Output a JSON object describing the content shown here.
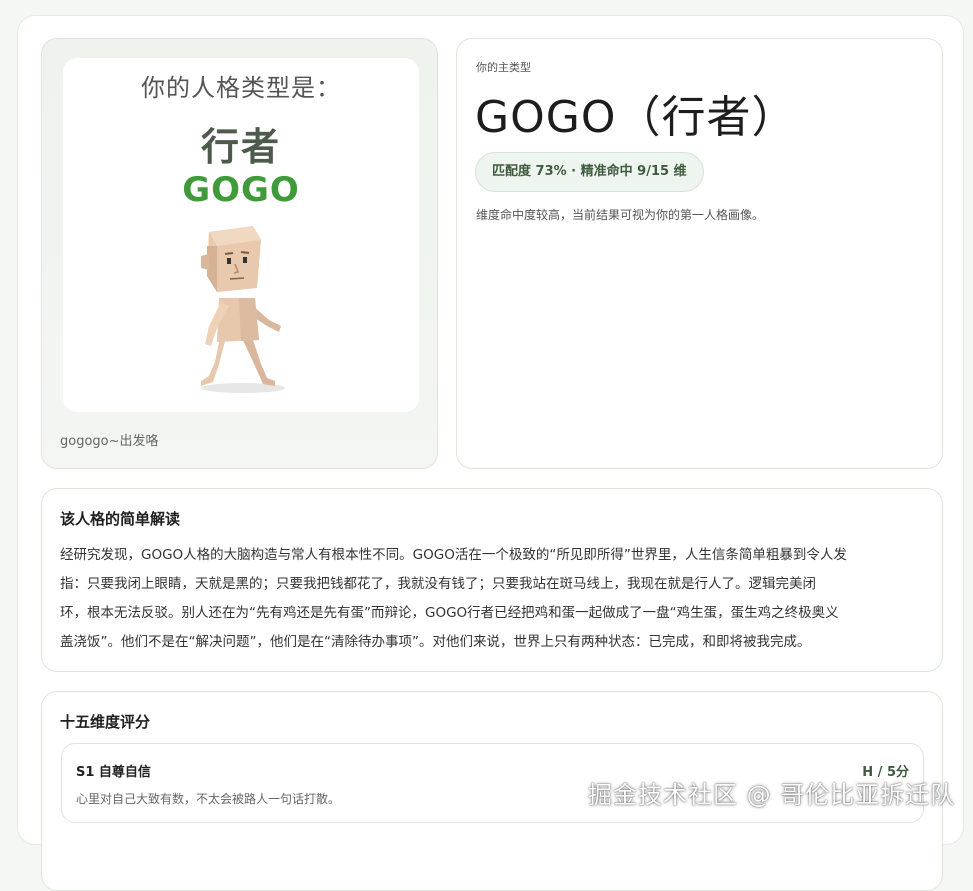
{
  "poster": {
    "heading": "你的人格类型是：",
    "name_cn": "行者",
    "name_en": "GOGO",
    "caption": "gogogo~出发咯"
  },
  "main_type": {
    "eyebrow": "你的主类型",
    "name": "GOGO（行者）",
    "badge": "匹配度 73% · 精准命中 9/15 维",
    "description": "维度命中度较高，当前结果可视为你的第一人格画像。"
  },
  "interpretation": {
    "title": "该人格的简单解读",
    "lines": [
      "经研究发现，GOGO人格的大脑构造与常人有根本性不同。GOGO活在一个极致的“所见即所得”世界里，人生信条简单粗暴到令人发",
      "指：只要我闭上眼睛，天就是黑的；只要我把钱都花了，我就没有钱了；只要我站在斑马线上，我现在就是行人了。逻辑完美闭",
      "环，根本无法反驳。别人还在为“先有鸡还是先有蛋”而辩论，GOGO行者已经把鸡和蛋一起做成了一盘“鸡生蛋，蛋生鸡之终极奥义",
      "盖浇饭”。他们不是在“解决问题”，他们是在“清除待办事项”。对他们来说，世界上只有两种状态：已完成，和即将被我完成。"
    ]
  },
  "dimensions": {
    "title": "十五维度评分",
    "items": [
      {
        "label": "S1 自尊自信",
        "score": "H / 5分",
        "description": "心里对自己大致有数，不太会被路人一句话打散。"
      }
    ]
  },
  "watermark": "掘金技术社区 @ 哥伦比亚拆迁队",
  "colors": {
    "accent_green": "#3f9a3a",
    "badge_bg": "#eef5ee",
    "border": "#dde6dd"
  }
}
